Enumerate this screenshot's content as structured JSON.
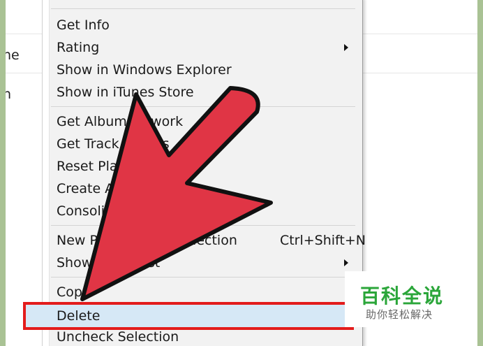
{
  "background": {
    "text_1": "ne",
    "text_2": "h"
  },
  "menu": {
    "items": [
      {
        "label": "Get Info"
      },
      {
        "label": "Rating",
        "submenu": true
      },
      {
        "label": "Show in Windows Explorer"
      },
      {
        "label": "Show in iTunes Store"
      },
      {
        "label": "Get Album Artwork"
      },
      {
        "label": "Get Track Names"
      },
      {
        "label": "Reset Plays"
      },
      {
        "label": "Create AAC Version"
      },
      {
        "label": "Consolidate Files..."
      },
      {
        "label": "New Playlist from Selection",
        "shortcut": "Ctrl+Shift+N"
      },
      {
        "label": "Show in Playlist",
        "submenu": true
      },
      {
        "label": "Copy"
      },
      {
        "label": "Delete",
        "highlighted": true
      },
      {
        "label": "Uncheck Selection"
      }
    ]
  },
  "colors": {
    "highlight_outline": "#e31c1c",
    "highlight_fill": "#d6e8f6",
    "pointer_arrow": "#e03545",
    "frame_border": "#a9c294",
    "watermark_green": "#2ba63a"
  },
  "watermark": {
    "title": "百科全说",
    "subtitle": "助你轻松解决"
  }
}
